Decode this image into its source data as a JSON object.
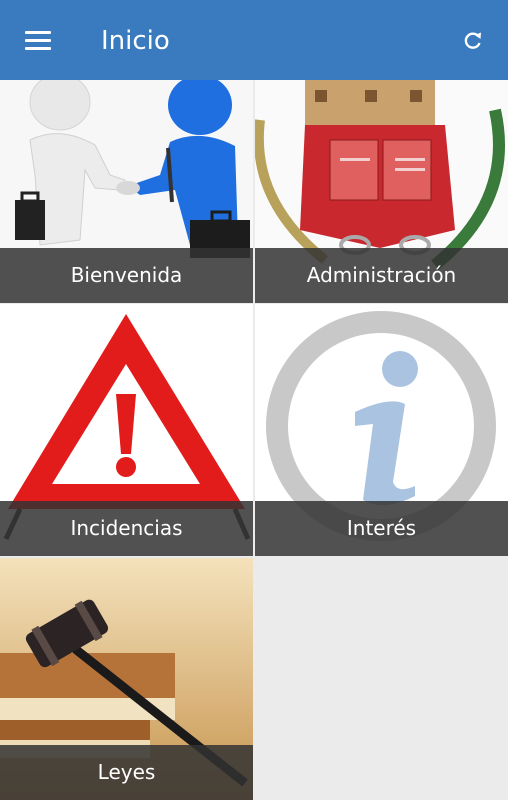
{
  "appbar": {
    "title": "Inicio",
    "menu_icon": "menu-icon",
    "refresh_icon": "refresh-icon",
    "color": "#3a7bbf"
  },
  "tiles": [
    {
      "label": "Bienvenida",
      "image": "handshake-image"
    },
    {
      "label": "Administración",
      "image": "coat-of-arms-image"
    },
    {
      "label": "Incidencias",
      "image": "warning-triangle-image"
    },
    {
      "label": "Interés",
      "image": "info-icon-image"
    },
    {
      "label": "Leyes",
      "image": "gavel-image"
    }
  ]
}
